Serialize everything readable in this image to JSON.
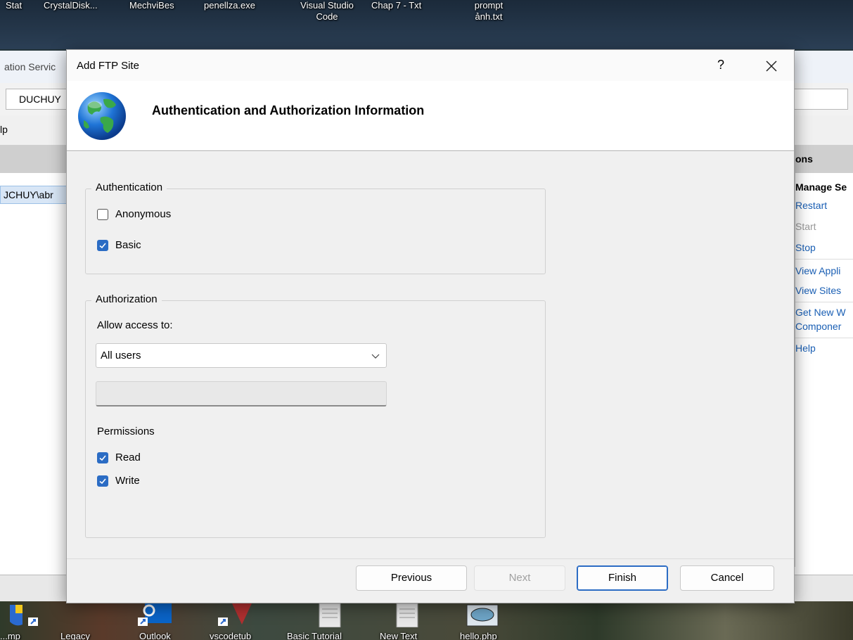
{
  "desktop": {
    "top_labels": [
      "Stat",
      "CrystalDisk...",
      "MechviBes",
      "penellza.exe",
      "Visual Studio Code",
      "Chap 7 - Txt",
      "prompt ảnh.txt"
    ],
    "bottom_labels": [
      "...mp",
      "Legacy",
      "Outlook",
      "vscodetub",
      "Basic Tutorial",
      "New Text",
      "hello.php"
    ]
  },
  "iis": {
    "title": "ation Servic",
    "address": "DUCHUY",
    "menu_help": "lp",
    "tree_item": "JCHUY\\abr",
    "actions": {
      "header": "ons",
      "manage": "Manage Se",
      "restart": "Restart",
      "start": "Start",
      "stop": "Stop",
      "view_apps": "View Appli",
      "view_sites": "View Sites",
      "get_new": "Get New W Componer",
      "help": "Help"
    }
  },
  "dialog": {
    "title": "Add FTP Site",
    "help_label": "?",
    "heading": "Authentication and Authorization Information",
    "authentication": {
      "legend": "Authentication",
      "anonymous": {
        "label": "Anonymous",
        "checked": false
      },
      "basic": {
        "label": "Basic",
        "checked": true
      }
    },
    "authorization": {
      "legend": "Authorization",
      "allow_label": "Allow access to:",
      "allow_value": "All users",
      "user_field_value": "",
      "permissions_label": "Permissions",
      "read": {
        "label": "Read",
        "checked": true
      },
      "write": {
        "label": "Write",
        "checked": true
      }
    },
    "buttons": {
      "previous": "Previous",
      "next": "Next",
      "finish": "Finish",
      "cancel": "Cancel"
    }
  },
  "colors": {
    "accent": "#2b6cc4",
    "link": "#1a5fb4"
  }
}
